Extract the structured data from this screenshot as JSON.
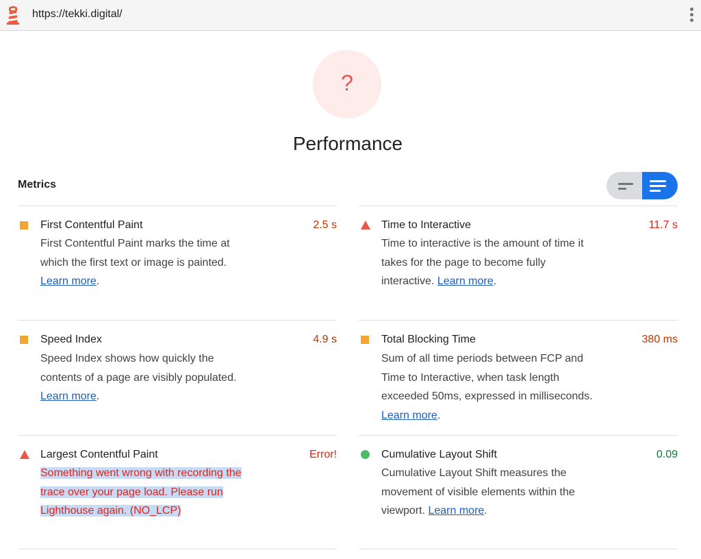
{
  "topbar": {
    "url": "https://tekki.digital/",
    "logo_icon": "lighthouse-icon",
    "menu_icon": "kebab-menu-icon"
  },
  "gauge": {
    "score": "?",
    "title": "Performance"
  },
  "metrics_header": {
    "label": "Metrics",
    "toggle_icons": [
      "compact-view-icon",
      "expanded-view-icon"
    ]
  },
  "metrics": [
    {
      "name": "First Contentful Paint",
      "value": "2.5 s",
      "status": "average",
      "desc_lines": [
        "First Contentful Paint marks the time at",
        "which the first text or image is painted."
      ],
      "link": "Learn more",
      "after_link": "."
    },
    {
      "name": "Time to Interactive",
      "value": "11.7 s",
      "status": "fail",
      "desc_lines": [
        "Time to interactive is the amount of time it",
        "takes for the page to become fully"
      ],
      "last_prefix": "interactive. ",
      "link": "Learn more",
      "after_link": "."
    },
    {
      "name": "Speed Index",
      "value": "4.9 s",
      "status": "average",
      "desc_lines": [
        "Speed Index shows how quickly the",
        "contents of a page are visibly populated."
      ],
      "link": "Learn more",
      "after_link": "."
    },
    {
      "name": "Total Blocking Time",
      "value": "380 ms",
      "status": "average",
      "desc_lines": [
        "Sum of all time periods between FCP and",
        "Time to Interactive, when task length",
        "exceeded 50ms, expressed in milliseconds."
      ],
      "link": "Learn more",
      "after_link": "."
    },
    {
      "name": "Largest Contentful Paint",
      "value": "Error!",
      "status": "fail",
      "error_lines": [
        "Something went wrong with recording the",
        "trace over your page load. Please run",
        "Lighthouse again. (NO_LCP)"
      ]
    },
    {
      "name": "Cumulative Layout Shift",
      "value": "0.09",
      "status": "pass",
      "desc_lines": [
        "Cumulative Layout Shift measures the",
        "movement of visible elements within the"
      ],
      "last_prefix": "viewport. ",
      "link": "Learn more",
      "after_link": "."
    }
  ],
  "colors": {
    "average": "#f4a531",
    "fail": "#e9564a",
    "pass": "#4cbb6c",
    "accent": "#1a73e8"
  }
}
